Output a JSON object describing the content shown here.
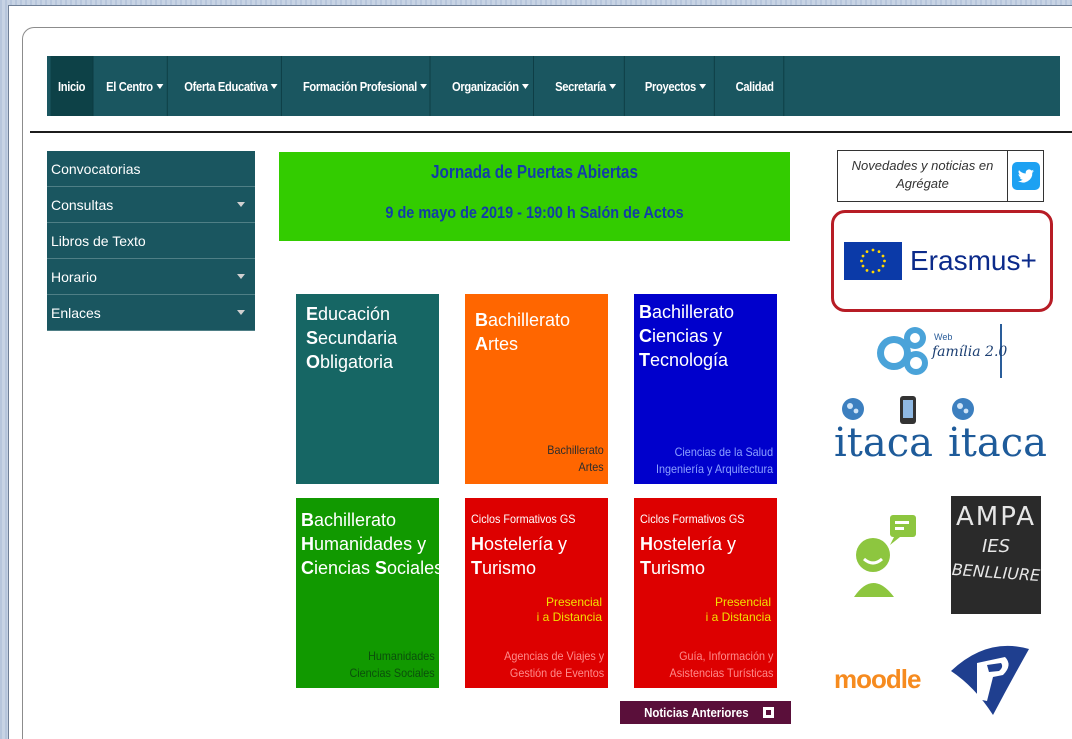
{
  "nav": {
    "items": [
      {
        "label": "Inicio",
        "caret": false
      },
      {
        "label": "El Centro",
        "caret": true
      },
      {
        "label": "Oferta Educativa",
        "caret": true
      },
      {
        "label": "Formación Profesional",
        "caret": true
      },
      {
        "label": "Organización",
        "caret": true
      },
      {
        "label": "Secretaría",
        "caret": true
      },
      {
        "label": "Proyectos",
        "caret": true
      },
      {
        "label": "Calidad",
        "caret": false
      }
    ]
  },
  "sidebar": {
    "items": [
      {
        "label": "Convocatorias",
        "caret": false
      },
      {
        "label": "Consultas",
        "caret": true
      },
      {
        "label": "Libros de Texto",
        "caret": false
      },
      {
        "label": "Horario",
        "caret": true
      },
      {
        "label": "Enlaces",
        "caret": true
      }
    ]
  },
  "banner": {
    "title": "Jornada de Puertas Abiertas",
    "subtitle": "9 de mayo de 2019  - 19:00 h Salón de Actos"
  },
  "tiles": {
    "eso": {
      "l1a": "E",
      "l1b": "ducación",
      "l2a": "S",
      "l2b": "ecundaria",
      "l3a": "O",
      "l3b": "bligatoria"
    },
    "artes": {
      "l1a": "B",
      "l1b": "achillerato",
      "l2a": "A",
      "l2b": "rtes",
      "foot1": "Bachillerato",
      "foot2": "Artes"
    },
    "ciencias": {
      "l1a": "B",
      "l1b": "achillerato",
      "l2a": "C",
      "l2b": "iencias y",
      "l3a": "T",
      "l3b": "ecnología",
      "foot1": "Ciencias de la Salud",
      "foot2": "Ingeniería y Arquitectura"
    },
    "humanidades": {
      "l1a": "B",
      "l1b": "achillerato",
      "l2a": "H",
      "l2b": "umanidades y",
      "l3a": "C",
      "l3b": "iencias ",
      "l3c": "S",
      "l3d": "ociales",
      "foot1": "Humanidades",
      "foot2": "Ciencias Sociales"
    },
    "hosteleria1": {
      "top": "Ciclos Formativos GS",
      "l1a": "H",
      "l1b": "ostelería y",
      "l2a": "T",
      "l2b": "urismo",
      "mid1": "Presencial",
      "mid2": "i a Distancia",
      "foot1": "Agencias de Viajes y",
      "foot2": "Gestión de Eventos"
    },
    "hosteleria2": {
      "top": "Ciclos Formativos GS",
      "l1a": "H",
      "l1b": "ostelería y",
      "l2a": "T",
      "l2b": "urismo",
      "mid1": "Presencial",
      "mid2": "i a Distancia",
      "foot1": "Guía, Información y",
      "foot2": "Asistencias Turísticas"
    }
  },
  "news_button": "Noticias Anteriores",
  "right": {
    "twitter_text1": "Novedades y noticias en",
    "twitter_text2": "Agrégate",
    "erasmus": "Erasmus+",
    "webfamilia1": "Web",
    "webfamilia2": "família 2.0",
    "itaca": "itaca",
    "ampa1": "AMPA",
    "ampa2": "IES",
    "ampa3": "BENLLIURE",
    "moodle": "moodle"
  },
  "colors": {
    "nav": "#1a5660",
    "banner": "#33cc00",
    "teal": "#166664",
    "orange": "#ff6600",
    "blue": "#0000cc",
    "green": "#119900",
    "red": "#dd0000",
    "news": "#5a0f3a"
  }
}
